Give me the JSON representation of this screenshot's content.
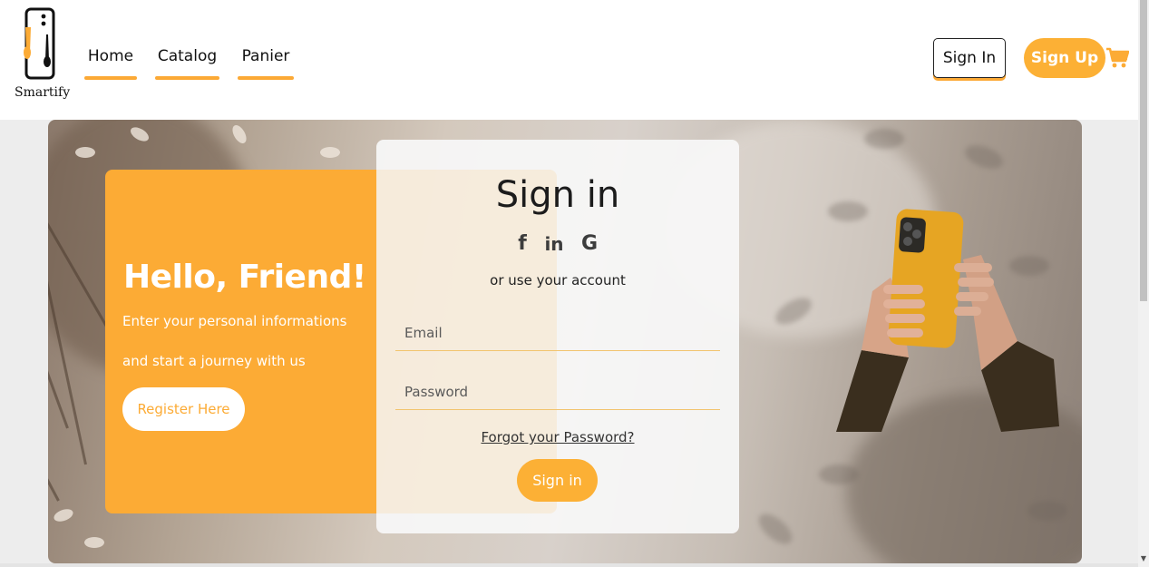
{
  "brand": {
    "name": "Smartify",
    "logo_icon": "phone-logo-icon"
  },
  "nav": {
    "links": [
      {
        "label": "Home"
      },
      {
        "label": "Catalog"
      },
      {
        "label": "Panier"
      }
    ],
    "sign_in_label": "Sign In",
    "sign_up_label": "Sign Up",
    "cart_icon": "cart-icon"
  },
  "welcome": {
    "title": "Hello, Friend!",
    "line1": "Enter your personal informations",
    "line2": "and start a journey with us",
    "register_label": "Register Here"
  },
  "signin_form": {
    "title": "Sign in",
    "socials": [
      {
        "icon": "facebook-icon",
        "glyph": "f"
      },
      {
        "icon": "linkedin-icon",
        "glyph": "in"
      },
      {
        "icon": "google-icon",
        "glyph": "G"
      }
    ],
    "alt_text": "or use your account",
    "email_placeholder": "Email",
    "email_value": "",
    "password_placeholder": "Password",
    "password_value": "",
    "forgot_label": "Forgot your Password?",
    "submit_label": "Sign in"
  },
  "colors": {
    "accent": "#fcab35",
    "accent_button": "#fcb035",
    "text_dark": "#1c1c1c",
    "page_bg": "#ededed"
  }
}
